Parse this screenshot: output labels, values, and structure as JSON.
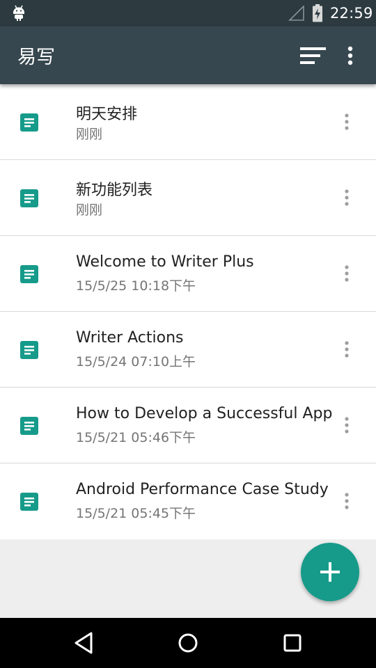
{
  "status_bar": {
    "time": "22:59",
    "icons": [
      "android-icon",
      "signal-icon",
      "battery-charging-icon"
    ]
  },
  "app_bar": {
    "title": "易写",
    "actions": [
      "sort-icon",
      "overflow-menu-icon"
    ]
  },
  "notes": [
    {
      "title": "明天安排",
      "date": "刚刚"
    },
    {
      "title": "新功能列表",
      "date": "刚刚"
    },
    {
      "title": "Welcome to Writer Plus",
      "date": "15/5/25 10:18下午"
    },
    {
      "title": "Writer Actions",
      "date": "15/5/24 07:10上午"
    },
    {
      "title": "How to Develop a Successful App",
      "date": "15/5/21 05:46下午"
    },
    {
      "title": "Android Performance Case Study",
      "date": "15/5/21 05:45下午"
    }
  ],
  "fab": {
    "icon": "plus-icon"
  },
  "nav_bar": {
    "buttons": [
      "back-icon",
      "home-icon",
      "recents-icon"
    ]
  },
  "colors": {
    "status_bar": "#2d3b41",
    "app_bar": "#37474f",
    "accent": "#169b8a",
    "background": "#eeeeee"
  }
}
